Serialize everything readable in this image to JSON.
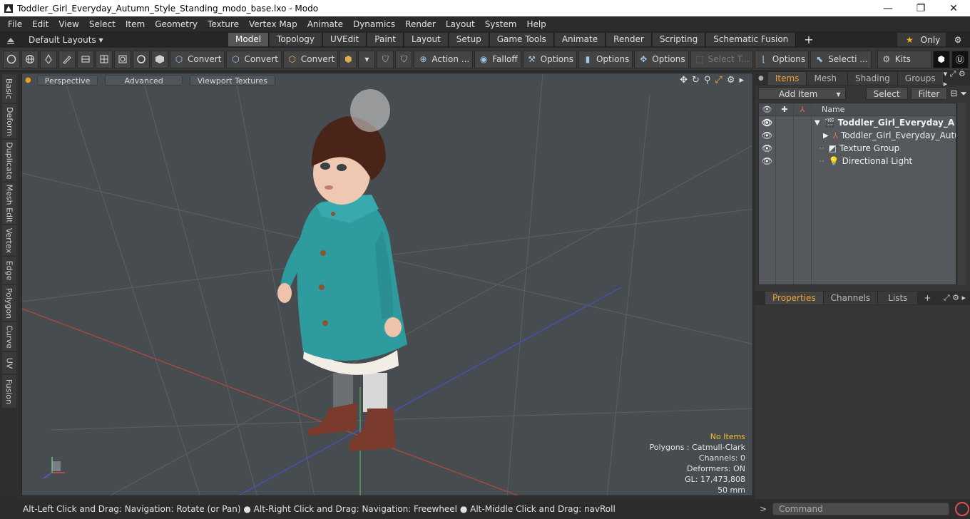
{
  "window": {
    "title": "Toddler_Girl_Everyday_Autumn_Style_Standing_modo_base.lxo - Modo",
    "minimize": "—",
    "maximize": "❐",
    "close": "✕"
  },
  "menu": [
    "File",
    "Edit",
    "View",
    "Select",
    "Item",
    "Geometry",
    "Texture",
    "Vertex Map",
    "Animate",
    "Dynamics",
    "Render",
    "Layout",
    "System",
    "Help"
  ],
  "layoutbar": {
    "layouts_label": "Default Layouts ▾",
    "tabs": [
      "Model",
      "Topology",
      "UVEdit",
      "Paint",
      "Layout",
      "Setup",
      "Game Tools",
      "Animate",
      "Render",
      "Scripting",
      "Schematic Fusion"
    ],
    "active_tab": "Model",
    "plus": "+",
    "only_label": "Only"
  },
  "toolbar": {
    "convert1": "Convert",
    "convert2": "Convert",
    "convert3": "Convert",
    "action": "Action",
    "action_more": "...",
    "falloff": "Falloff",
    "options1": "Options",
    "options2": "Options",
    "options3": "Options",
    "select_t": "Select T...",
    "options4": "Options",
    "selecti": "Selecti ...",
    "kits": "Kits"
  },
  "left_tabs": [
    "Basic",
    "Deform",
    "Duplicate",
    "Mesh Edit",
    "Vertex",
    "Edge",
    "Polygon",
    "Curve",
    "UV",
    "Fusion"
  ],
  "viewport": {
    "view_mode": "Perspective",
    "advanced": "Advanced",
    "textures": "Viewport Textures",
    "stats": {
      "no_items": "No Items",
      "polygons": "Polygons : Catmull-Clark",
      "channels": "Channels: 0",
      "deformers": "Deformers: ON",
      "gl": "GL: 17,473,808",
      "focal": "50 mm"
    }
  },
  "statusbar": {
    "hint": "Alt-Left Click and Drag: Navigation: Rotate (or Pan) ● Alt-Right Click and Drag: Navigation: Freewheel ● Alt-Middle Click and Drag: navRoll"
  },
  "items_panel": {
    "tabs": [
      "Items",
      "Mesh ...",
      "Shading",
      "Groups"
    ],
    "add_item": "Add Item",
    "select": "Select",
    "filter": "Filter",
    "name_header": "Name",
    "rows": [
      {
        "name": "Toddler_Girl_Everyday_A ..."
      },
      {
        "name": "Toddler_Girl_Everyday_Autu..."
      },
      {
        "name": "Texture Group"
      },
      {
        "name": "Directional Light"
      }
    ]
  },
  "properties_panel": {
    "tabs": [
      "Properties",
      "Channels",
      "Lists"
    ],
    "plus": "+"
  },
  "command": {
    "placeholder": "Command"
  },
  "colors": {
    "accent": "#f0a030",
    "viewport_bg": "#474c50",
    "coat": "#2e9b9f",
    "hat": "#4a2418",
    "boots": "#7a3a2c"
  }
}
